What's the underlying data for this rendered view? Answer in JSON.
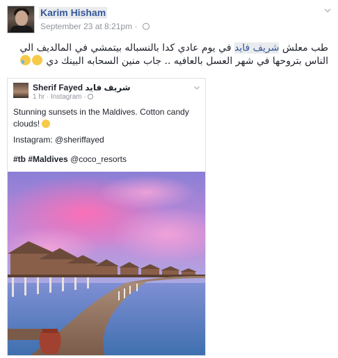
{
  "post": {
    "author": "Karim Hisham",
    "timestamp": "September 23 at 8:21pm",
    "separator": "·",
    "text_before": "طب معلش ",
    "mention": "شريف فايد",
    "text_after": " في يوم عادي كدا بالنسباله بيتمشي في المالديف الي الناس بتروحها في شهر العسل بالعافيه .. جاب منين السحابه البينك دي"
  },
  "shared_post": {
    "author": "Sherif Fayed",
    "author_arabic": "شريف فايد",
    "meta": "1 hr · Instagram · ",
    "caption_line1": "Stunning sunsets in the Maldives. Cotton candy clouds!",
    "caption_line2": "Instagram: @sheriffayed",
    "tags": [
      "#tb",
      "#Maldives",
      "@coco_resorts"
    ]
  },
  "icons": {
    "options": "chevron-down-icon",
    "audience": "globe-icon",
    "emoji_laugh": "laughing-emoji-icon",
    "emoji_cry": "crying-laughing-emoji-icon",
    "emoji_smile": "smiling-emoji-icon"
  },
  "colors": {
    "link": "#365899",
    "mention_bg": "#e9ebee",
    "meta": "#90949c",
    "border": "#dddfe2"
  }
}
